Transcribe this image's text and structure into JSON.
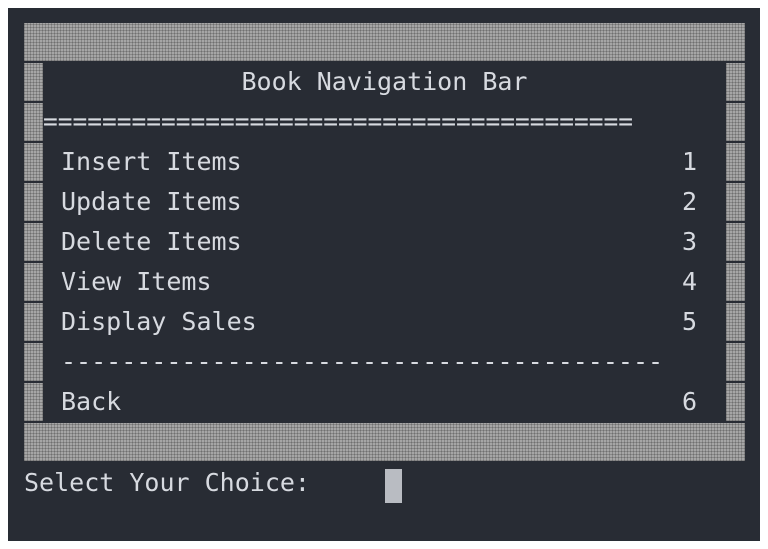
{
  "menu": {
    "title": "Book Navigation Bar",
    "double_rule": "========================================",
    "single_rule": "----------------------------------------",
    "items": [
      {
        "label": "Insert Items",
        "number": "1"
      },
      {
        "label": "Update Items",
        "number": "2"
      },
      {
        "label": "Delete Items",
        "number": "3"
      },
      {
        "label": "View Items",
        "number": "4"
      },
      {
        "label": "Display Sales",
        "number": "5"
      }
    ],
    "back": {
      "label": "Back",
      "number": "6"
    }
  },
  "prompt": {
    "text": "Select Your Choice:"
  },
  "colors": {
    "background": "#282c34",
    "text": "#d7dae0",
    "shade_block": "#a6a6a6",
    "cursor": "#b9bcc2"
  }
}
